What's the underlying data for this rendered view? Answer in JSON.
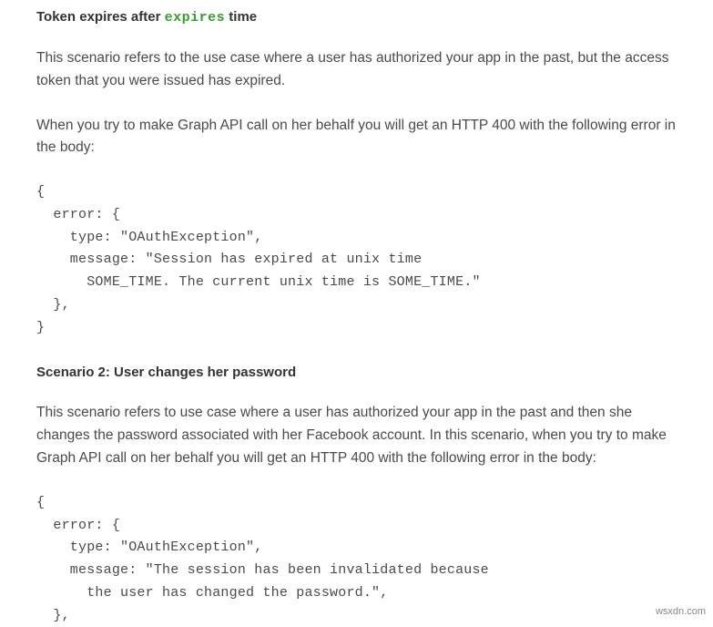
{
  "section1": {
    "heading_prefix": "Token expires after ",
    "heading_keyword": "expires",
    "heading_suffix": " time",
    "paragraph1": "This scenario refers to the use case where a user has authorized your app in the past, but the access token that you were issued has expired.",
    "paragraph2": "When you try to make Graph API call on her behalf you will get an HTTP 400 with the following error in the body:",
    "code": "{\n  error: {\n    type: \"OAuthException\",\n    message: \"Session has expired at unix time\n      SOME_TIME. The current unix time is SOME_TIME.\"\n  },\n}"
  },
  "section2": {
    "heading": "Scenario 2: User changes her password",
    "paragraph1": "This scenario refers to use case where a user has authorized your app in the past and then she changes the password associated with her Facebook account. In this scenario, when you try to make Graph API call on her behalf you will get an HTTP 400 with the following error in the body:",
    "code": "{\n  error: {\n    type: \"OAuthException\",\n    message: \"The session has been invalidated because\n      the user has changed the password.\",\n  },"
  },
  "watermark": "wsxdn.com"
}
